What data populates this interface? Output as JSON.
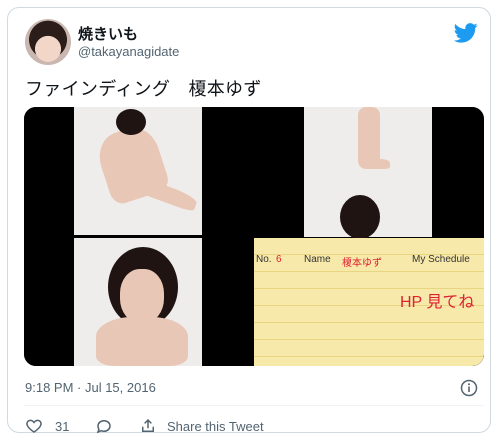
{
  "tweet": {
    "author": {
      "display_name": "焼きいも",
      "handle": "@takayanagidate",
      "avatar_icon": "user-avatar"
    },
    "brand_icon": "twitter-bird-icon",
    "brand_color": "#1d9bf0",
    "text": "ファインディング　榎本ゆず",
    "timestamp": "9:18 PM · Jul 15, 2016",
    "like_count": "31",
    "share_label": "Share this Tweet",
    "schedule_card": {
      "no_label": "No.",
      "no_value": "6",
      "name_label": "Name",
      "name_value": "榎本ゆず",
      "header": "My Schedule",
      "note": "HP 見てね"
    }
  }
}
